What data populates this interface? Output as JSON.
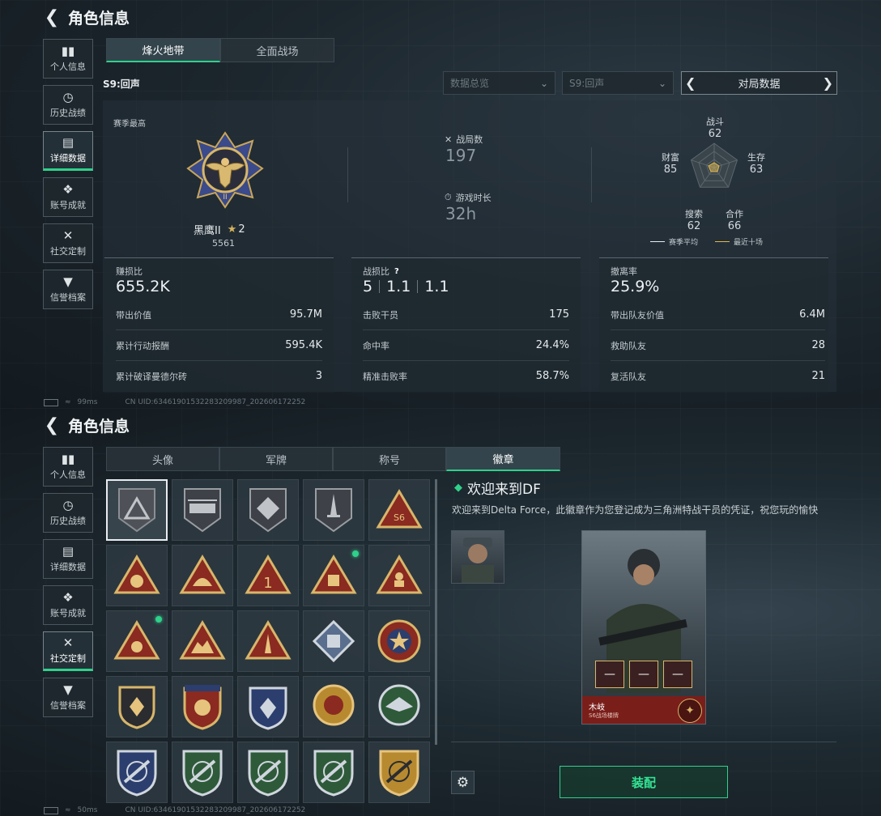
{
  "screen1": {
    "title": "角色信息",
    "sidebar": [
      {
        "label": "个人信息",
        "icon": "bar-chart-icon",
        "glyph": "▮▮",
        "active": false
      },
      {
        "label": "历史战绩",
        "icon": "clock-icon",
        "glyph": "◷",
        "active": false
      },
      {
        "label": "详细数据",
        "icon": "folder-icon",
        "glyph": "▤",
        "active": true
      },
      {
        "label": "账号成就",
        "icon": "diamond-badge-icon",
        "glyph": "❖",
        "active": false
      },
      {
        "label": "社交定制",
        "icon": "tools-icon",
        "glyph": "✕",
        "active": false
      },
      {
        "label": "信誉档案",
        "icon": "shield-file-icon",
        "glyph": "▼",
        "active": false
      }
    ],
    "mode_tabs": [
      "烽火地带",
      "全面战场"
    ],
    "season_label": "S9:回声",
    "dropdowns": {
      "overview": "数据总览",
      "season": "S9:回声"
    },
    "pager_label": "对局数据",
    "season_best_label": "赛季最高",
    "rank": {
      "name": "黑鹰II",
      "stars": "2",
      "points": "5561"
    },
    "matches": {
      "label": "战局数",
      "value": "197"
    },
    "playtime": {
      "label": "游戏时长",
      "value": "32h"
    },
    "radar": {
      "axes": [
        {
          "label": "战斗",
          "value": "62"
        },
        {
          "label": "生存",
          "value": "63"
        },
        {
          "label": "合作",
          "value": "66"
        },
        {
          "label": "搜索",
          "value": "62"
        },
        {
          "label": "财富",
          "value": "85"
        }
      ],
      "legend": [
        "赛季平均",
        "最近十场"
      ],
      "avg_color": "#e8ecef",
      "recent_color": "#e0b84a"
    },
    "statboxes": [
      {
        "head": "赚损比",
        "big": "655.2K",
        "rows": [
          {
            "k": "带出价值",
            "v": "95.7M"
          },
          {
            "k": "累计行动报酬",
            "v": "595.4K"
          },
          {
            "k": "累计破译曼德尔砖",
            "v": "3"
          }
        ]
      },
      {
        "head": "战损比",
        "kd": [
          "5",
          "1.1",
          "1.1"
        ],
        "rows": [
          {
            "k": "击败干员",
            "v": "175"
          },
          {
            "k": "命中率",
            "v": "24.4%"
          },
          {
            "k": "精准击败率",
            "v": "58.7%"
          }
        ]
      },
      {
        "head": "撤离率",
        "big": "25.9%",
        "rows": [
          {
            "k": "带出队友价值",
            "v": "6.4M"
          },
          {
            "k": "救助队友",
            "v": "28"
          },
          {
            "k": "复活队友",
            "v": "21"
          }
        ]
      }
    ],
    "ping": "99ms",
    "uid": "CN UID:6346190153228320998­7_202606172252"
  },
  "screen2": {
    "title": "角色信息",
    "sidebar": [
      {
        "label": "个人信息",
        "icon": "bar-chart-icon",
        "glyph": "▮▮",
        "active": false
      },
      {
        "label": "历史战绩",
        "icon": "clock-icon",
        "glyph": "◷",
        "active": false
      },
      {
        "label": "详细数据",
        "icon": "folder-icon",
        "glyph": "▤",
        "active": false
      },
      {
        "label": "账号成就",
        "icon": "diamond-badge-icon",
        "glyph": "❖",
        "active": false
      },
      {
        "label": "社交定制",
        "icon": "tools-icon",
        "glyph": "✕",
        "active": true
      },
      {
        "label": "信誉档案",
        "icon": "shield-file-icon",
        "glyph": "▼",
        "active": false
      }
    ],
    "tabs": [
      "头像",
      "军牌",
      "称号",
      "徽章"
    ],
    "detail": {
      "title": "欢迎来到DF",
      "desc": "欢迎来到Delta Force，此徽章作为您登记成为三角洲特战干员的凭证，祝您玩的愉快",
      "card_name": "木岐",
      "card_sub": "S6战场楼牌"
    },
    "equip_label": "装配",
    "ping": "50ms",
    "uid": "CN UID:6346190153228320998­7_202606172252"
  }
}
